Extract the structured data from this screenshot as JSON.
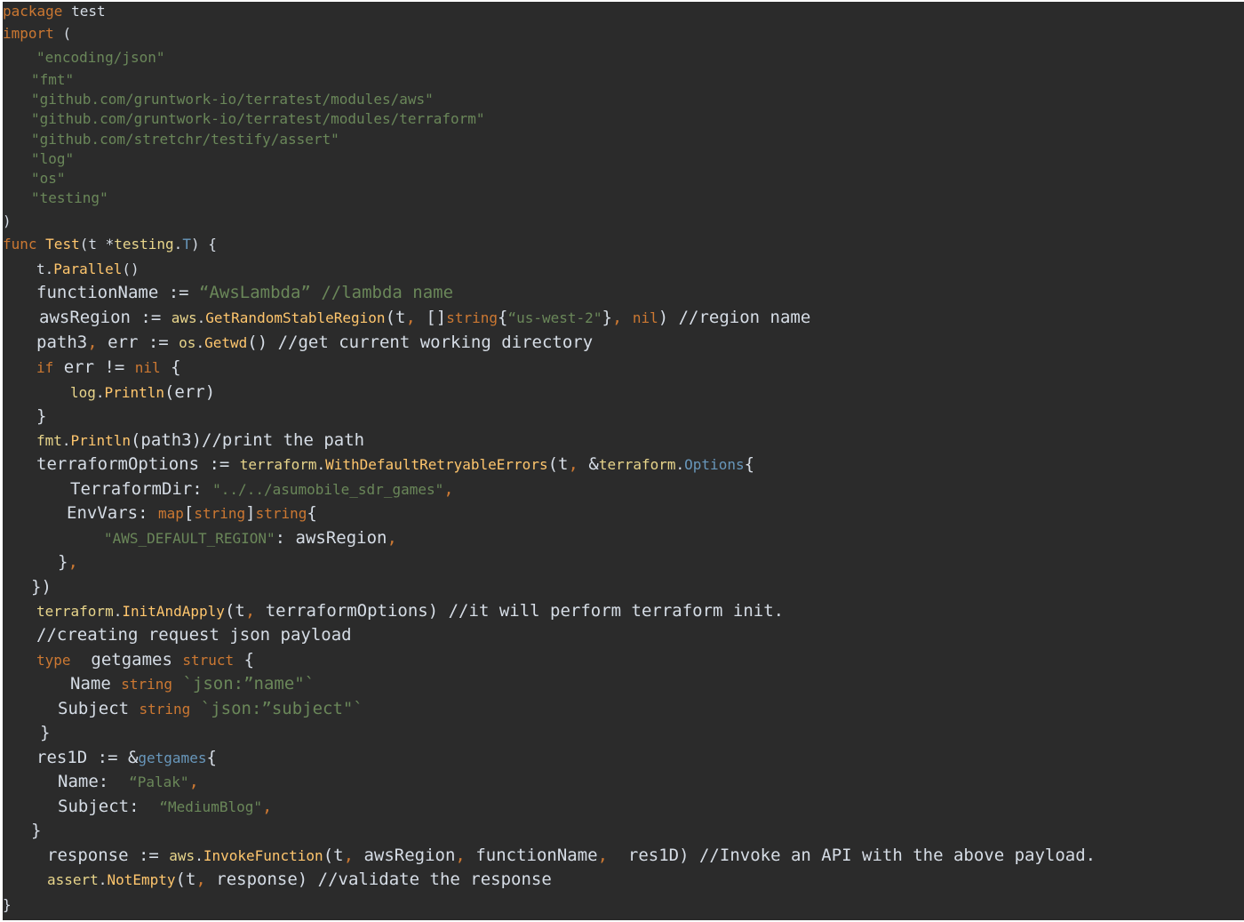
{
  "lines": [
    "package test",
    "import (",
    "\"encoding/json\"",
    "\"fmt\"",
    "\"github.com/gruntwork-io/terratest/modules/aws\"",
    "\"github.com/gruntwork-io/terratest/modules/terraform\"",
    "\"github.com/stretchr/testify/assert\"",
    "\"log\"",
    "\"os\"",
    "\"testing\"",
    ")",
    "func Test(t *testing.T) {",
    "t.Parallel()",
    "functionName := “AwsLambda” //lambda name",
    "awsRegion := aws.GetRandomStableRegion(t, []string{“us-west-2\"}, nil) //region name",
    "path3, err := os.Getwd() //get current working directory",
    "if err != nil {",
    "log.Println(err)",
    "}",
    "fmt.Println(path3)//print the path",
    "terraformOptions := terraform.WithDefaultRetryableErrors(t, &terraform.Options{",
    "TerraformDir: \"../../asumobile_sdr_games\",",
    "EnvVars: map[string]string{",
    "\"AWS_DEFAULT_REGION\": awsRegion,",
    "},",
    "})",
    "terraform.InitAndApply(t, terraformOptions) //it will perform terraform init.",
    "//creating request json payload",
    "type getgames struct {",
    "Name string `json:”name\"`",
    "Subject string `json:”subject\"`",
    "}",
    "res1D := &getgames{",
    "Name: “Palak\",",
    "Subject: “MediumBlog\",",
    "}",
    "response := aws.InvokeFunction(t, awsRegion, functionName, res1D) //Invoke an API with the above payload.",
    "assert.NotEmpty(t, response) //validate the response",
    "}"
  ]
}
